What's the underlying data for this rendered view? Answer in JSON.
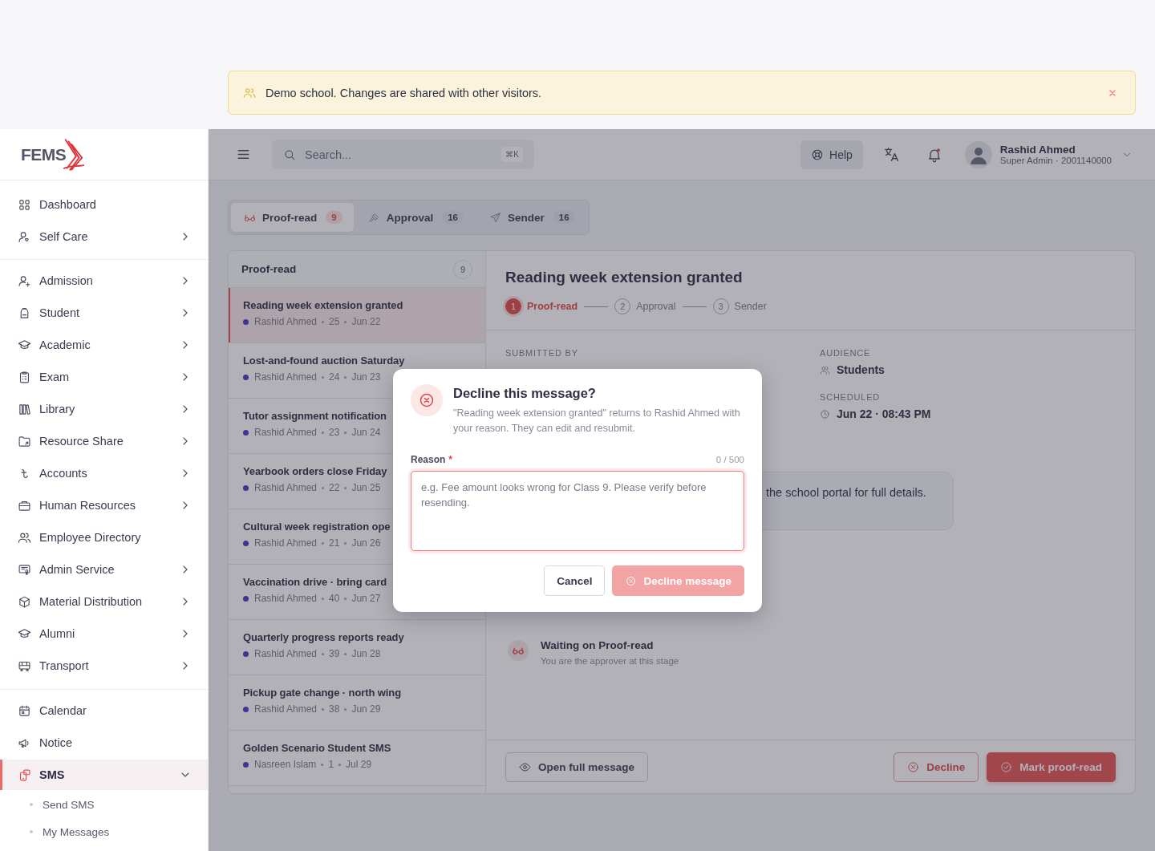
{
  "banner": {
    "text": "Demo school. Changes are shared with other visitors.",
    "dismissible": true
  },
  "sidebar": {
    "logo": "FEMS",
    "sections": [
      {
        "items": [
          {
            "label": "Dashboard",
            "has_children": false,
            "selected": false
          },
          {
            "label": "Self Care",
            "has_children": true,
            "selected": false
          }
        ]
      },
      {
        "items": [
          {
            "label": "Admission",
            "has_children": true,
            "selected": false
          },
          {
            "label": "Student",
            "has_children": true,
            "selected": false
          },
          {
            "label": "Academic",
            "has_children": true,
            "selected": false
          },
          {
            "label": "Exam",
            "has_children": true,
            "selected": false
          },
          {
            "label": "Library",
            "has_children": true,
            "selected": false
          },
          {
            "label": "Resource Share",
            "has_children": true,
            "selected": false
          },
          {
            "label": "Accounts",
            "has_children": true,
            "selected": false
          },
          {
            "label": "Human Resources",
            "has_children": true,
            "selected": false
          },
          {
            "label": "Employee Directory",
            "has_children": false,
            "selected": false
          },
          {
            "label": "Admin Service",
            "has_children": true,
            "selected": false
          },
          {
            "label": "Material Distribution",
            "has_children": true,
            "selected": false
          },
          {
            "label": "Alumni",
            "has_children": true,
            "selected": false
          },
          {
            "label": "Transport",
            "has_children": true,
            "selected": false
          }
        ]
      },
      {
        "items": [
          {
            "label": "Calendar",
            "has_children": false,
            "selected": false
          },
          {
            "label": "Notice",
            "has_children": false,
            "selected": false
          },
          {
            "label": "SMS",
            "has_children": true,
            "selected": true,
            "expanded": true,
            "children": [
              {
                "label": "Send SMS",
                "selected": false
              },
              {
                "label": "My Messages",
                "selected": false
              }
            ]
          }
        ]
      }
    ]
  },
  "header": {
    "search": {
      "placeholder": "Search...",
      "shortcut": "⌘K"
    },
    "help": "Help",
    "notifications_unread": true,
    "user": {
      "name": "Rashid Ahmed",
      "role": "Super Admin · 2001140000"
    }
  },
  "tabs": [
    {
      "label": "Proof-read",
      "count": "9",
      "selected": true
    },
    {
      "label": "Approval",
      "count": "16",
      "selected": false
    },
    {
      "label": "Sender",
      "count": "16",
      "selected": false
    }
  ],
  "queue": {
    "title": "Proof-read",
    "count": "9",
    "items": [
      {
        "title": "Reading week extension granted",
        "author": "Rashid Ahmed",
        "count": "25",
        "date": "Jun 22",
        "selected": true
      },
      {
        "title": "Lost-and-found auction Saturday",
        "author": "Rashid Ahmed",
        "count": "24",
        "date": "Jun 23",
        "selected": false
      },
      {
        "title": "Tutor assignment notification",
        "author": "Rashid Ahmed",
        "count": "23",
        "date": "Jun 24",
        "selected": false
      },
      {
        "title": "Yearbook orders close Friday",
        "author": "Rashid Ahmed",
        "count": "22",
        "date": "Jun 25",
        "selected": false
      },
      {
        "title": "Cultural week registration ope",
        "author": "Rashid Ahmed",
        "count": "21",
        "date": "Jun 26",
        "selected": false
      },
      {
        "title": "Vaccination drive · bring card",
        "author": "Rashid Ahmed",
        "count": "40",
        "date": "Jun 27",
        "selected": false
      },
      {
        "title": "Quarterly progress reports ready",
        "author": "Rashid Ahmed",
        "count": "39",
        "date": "Jun 28",
        "selected": false
      },
      {
        "title": "Pickup gate change · north wing",
        "author": "Rashid Ahmed",
        "count": "38",
        "date": "Jun 29",
        "selected": false
      },
      {
        "title": "Golden Scenario Student SMS",
        "author": "Nasreen Islam",
        "count": "1",
        "date": "Jul 29",
        "selected": false
      }
    ]
  },
  "detail": {
    "title": "Reading week extension granted",
    "steps": [
      {
        "number": "1",
        "label": "Proof-read",
        "current": true
      },
      {
        "number": "2",
        "label": "Approval",
        "current": false
      },
      {
        "number": "3",
        "label": "Sender",
        "current": false
      }
    ],
    "submitted_by_label": "SUBMITTED BY",
    "audience_label": "AUDIENCE",
    "audience": "Students",
    "scheduled_label": "SCHEDULED",
    "scheduled": "Jun 22 · 08:43 PM",
    "message_excerpt": "the school portal for full details.",
    "status": {
      "title": "Waiting on Proof-read",
      "subtitle": "You are the approver at this stage"
    },
    "actions": {
      "open": "Open full message",
      "decline": "Decline",
      "approve": "Mark proof-read"
    }
  },
  "modal": {
    "title": "Decline this message?",
    "description": "\"Reading week extension granted\" returns to Rashid Ahmed with your reason. They can edit and resubmit.",
    "reason_label": "Reason",
    "required": true,
    "required_mark": "*",
    "counter": "0 / 500",
    "placeholder": "e.g. Fee amount looks wrong for Class 9. Please verify before resending.",
    "cancel": "Cancel",
    "confirm": "Decline message",
    "confirm_disabled": true
  }
}
